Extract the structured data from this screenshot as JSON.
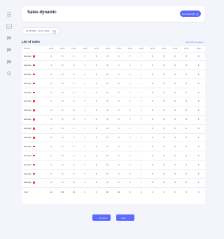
{
  "page": {
    "title": "Sales dynamic"
  },
  "header": {
    "download_label": "Download File"
  },
  "filter": {
    "date_range": "21.05.2024 – 21.07.2024"
  },
  "list": {
    "title": "List of sales",
    "per_page_label": "100 rows per page"
  },
  "table": {
    "columns": [
      "Country",
      "11.05",
      "11.05",
      "11.05",
      "11.05",
      "11.05",
      "11.05",
      "11.05",
      "11.05",
      "11.05",
      "11.05",
      "11.05",
      "11.05",
      "11.05",
      "Total"
    ],
    "rows": [
      {
        "country": "Germany",
        "cells": [
          "1",
          "90",
          "49",
          "0",
          "0",
          "90",
          "49",
          "0",
          "0",
          "0",
          "0",
          "0",
          "0",
          "0"
        ]
      },
      {
        "country": "Germany",
        "cells": [
          "1",
          "90",
          "49",
          "0",
          "0",
          "90",
          "49",
          "0",
          "0",
          "0",
          "0",
          "0",
          "0",
          "0"
        ]
      },
      {
        "country": "Germany",
        "cells": [
          "1",
          "90",
          "49",
          "0",
          "0",
          "90",
          "49",
          "0",
          "0",
          "0",
          "0",
          "0",
          "0",
          "0"
        ]
      },
      {
        "country": "Germany",
        "cells": [
          "1",
          "90",
          "49",
          "0",
          "0",
          "90",
          "49",
          "0",
          "0",
          "0",
          "0",
          "0",
          "0",
          "0"
        ]
      },
      {
        "country": "Germany",
        "cells": [
          "1",
          "90",
          "49",
          "0",
          "0",
          "90",
          "49",
          "0",
          "0",
          "0",
          "0",
          "0",
          "0",
          "0"
        ]
      },
      {
        "country": "Germany",
        "cells": [
          "1",
          "90",
          "49",
          "0",
          "0",
          "90",
          "49",
          "0",
          "0",
          "0",
          "0",
          "0",
          "0",
          "0"
        ]
      },
      {
        "country": "Germany",
        "cells": [
          "1",
          "90",
          "49",
          "0",
          "0",
          "90",
          "49",
          "0",
          "0",
          "0",
          "0",
          "0",
          "0",
          "0"
        ]
      },
      {
        "country": "Germany",
        "cells": [
          "1",
          "90",
          "49",
          "0",
          "0",
          "90",
          "49",
          "0",
          "0",
          "0",
          "0",
          "0",
          "0",
          "0"
        ]
      },
      {
        "country": "Germany",
        "cells": [
          "1",
          "90",
          "49",
          "0",
          "0",
          "90",
          "49",
          "0",
          "0",
          "0",
          "0",
          "0",
          "0",
          "0"
        ]
      },
      {
        "country": "Germany",
        "cells": [
          "1",
          "90",
          "49",
          "0",
          "0",
          "90",
          "49",
          "0",
          "0",
          "0",
          "0",
          "0",
          "0",
          "0"
        ]
      },
      {
        "country": "Germany",
        "cells": [
          "1",
          "90",
          "49",
          "0",
          "0",
          "90",
          "49",
          "0",
          "0",
          "0",
          "0",
          "0",
          "0",
          "0"
        ]
      },
      {
        "country": "Germany",
        "cells": [
          "1",
          "90",
          "49",
          "0",
          "0",
          "90",
          "49",
          "0",
          "0",
          "0",
          "0",
          "0",
          "0",
          "0"
        ]
      },
      {
        "country": "Germany",
        "cells": [
          "1",
          "90",
          "49",
          "0",
          "0",
          "90",
          "49",
          "0",
          "0",
          "0",
          "0",
          "0",
          "0",
          "0"
        ]
      },
      {
        "country": "Germany",
        "cells": [
          "1",
          "90",
          "49",
          "0",
          "0",
          "90",
          "49",
          "0",
          "0",
          "0",
          "0",
          "0",
          "0",
          "0"
        ]
      },
      {
        "country": "Germany",
        "cells": [
          "1",
          "90",
          "49",
          "0",
          "0",
          "90",
          "49",
          "0",
          "0",
          "0",
          "0",
          "0",
          "0",
          "0"
        ]
      }
    ],
    "cell_colors": [
      "",
      "green",
      "yellow",
      "red",
      "",
      "green",
      "yellow",
      "red",
      "yellow",
      "",
      "",
      "",
      "",
      ""
    ],
    "total": {
      "label": "Total",
      "cells": [
        "12",
        "190",
        "49",
        "0",
        "0",
        "90",
        "49",
        "0",
        "0",
        "0",
        "0",
        "0",
        "0",
        "0"
      ]
    }
  },
  "pagination": {
    "previous_label": "Previous",
    "next_label": "Next"
  },
  "icons": [
    "grid-icon",
    "inbox-icon",
    "chat-icon",
    "chat-icon",
    "chat-icon",
    "settings-icon"
  ],
  "colors": {
    "accent": "#5b6bff",
    "flag": "#e03c3c",
    "up": "#35b56a",
    "down": "#e0484d",
    "neutral": "#d4a425"
  }
}
